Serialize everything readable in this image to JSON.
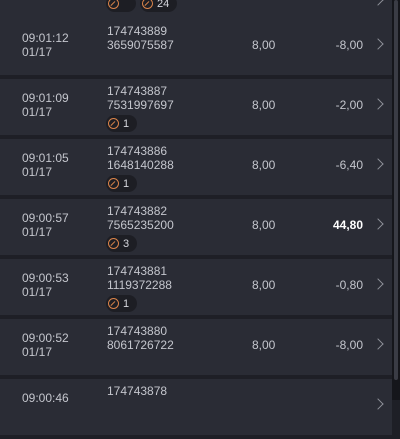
{
  "rows": [
    {
      "time": "",
      "date": "",
      "id1": "",
      "id2": "",
      "stake": "",
      "result": "",
      "chips": [
        "",
        "24"
      ]
    },
    {
      "time": "09:01:12",
      "date": "01/17",
      "id1": "174743889",
      "id2": "3659075587",
      "stake": "8,00",
      "result": "-8,00",
      "chips": []
    },
    {
      "time": "09:01:09",
      "date": "01/17",
      "id1": "174743887",
      "id2": "7531997697",
      "stake": "8,00",
      "result": "-2,00",
      "chips": [
        "1"
      ]
    },
    {
      "time": "09:01:05",
      "date": "01/17",
      "id1": "174743886",
      "id2": "1648140288",
      "stake": "8,00",
      "result": "-6,40",
      "chips": [
        "1"
      ]
    },
    {
      "time": "09:00:57",
      "date": "01/17",
      "id1": "174743882",
      "id2": "7565235200",
      "stake": "8,00",
      "result": "44,80",
      "chips": [
        "3"
      ]
    },
    {
      "time": "09:00:53",
      "date": "01/17",
      "id1": "174743881",
      "id2": "1119372288",
      "stake": "8,00",
      "result": "-0,80",
      "chips": [
        "1"
      ]
    },
    {
      "time": "09:00:52",
      "date": "01/17",
      "id1": "174743880",
      "id2": "8061726722",
      "stake": "8,00",
      "result": "-8,00",
      "chips": []
    },
    {
      "time": "09:00:46",
      "date": "",
      "id1": "174743878",
      "id2": "",
      "stake": "",
      "result": "",
      "chips": []
    }
  ],
  "icons": {
    "chip": "multiplier-ring-icon",
    "row_chevron": "chevron-right-icon"
  },
  "colors": {
    "background": "#1e1f26",
    "row": "#2a2c35",
    "accent": "#d9834a",
    "win": "#ffffff"
  }
}
